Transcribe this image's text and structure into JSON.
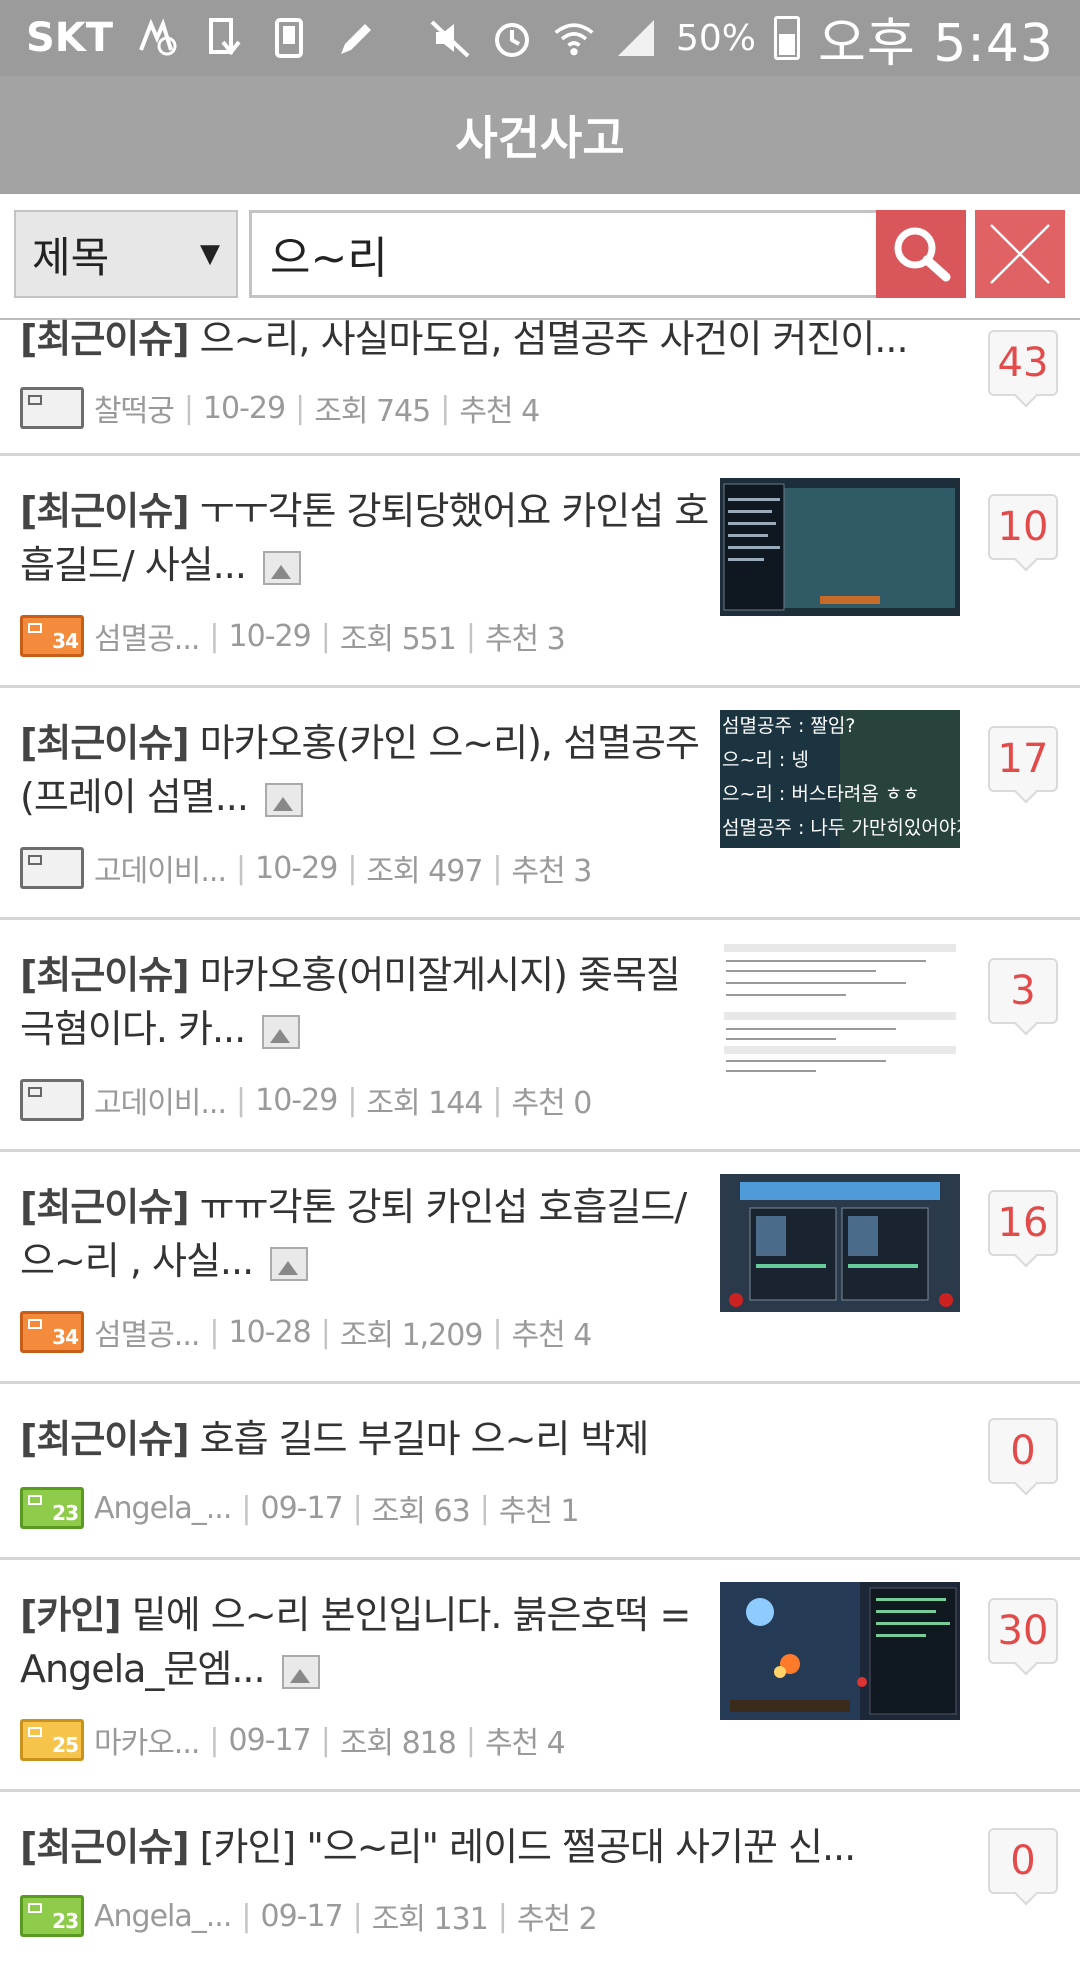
{
  "status_bar": {
    "carrier": "SKT",
    "battery": "50%",
    "time": "오후 5:43",
    "icons": [
      "notification-icon",
      "sd-card-icon",
      "sim-icon",
      "pen-icon",
      "mute-icon",
      "alarm-icon",
      "wifi-icon",
      "signal-icon",
      "battery-icon"
    ]
  },
  "header": {
    "title": "사건사고"
  },
  "search": {
    "field_option": "제목",
    "query": "으~리"
  },
  "posts": [
    {
      "tag": "[최근이슈]",
      "text": "으~리, 사실마도임, 섬멸공주 사건이 커진이...",
      "has_image": false,
      "level": "",
      "level_color": "gray",
      "author": "찰떡궁",
      "date": "10-29",
      "views": "조회 745",
      "recommend": "추천 4",
      "comments": "43"
    },
    {
      "tag": "[최근이슈]",
      "text": "ㅜㅜ각톤 강퇴당했어요 카인섭 호흡길드/ 사실...",
      "has_image": true,
      "level": "34",
      "level_color": "orange",
      "author": "섬멸공...",
      "date": "10-29",
      "views": "조회 551",
      "recommend": "추천 3",
      "comments": "10",
      "thumb": "game-chat-screenshot"
    },
    {
      "tag": "[최근이슈]",
      "text": "마카오홍(카인 으~리), 섬멸공주 (프레이 섬멸...",
      "has_image": true,
      "level": "",
      "level_color": "gray",
      "author": "고데이비...",
      "date": "10-29",
      "views": "조회 497",
      "recommend": "추천 3",
      "comments": "17",
      "thumb": "game-dialog-screenshot",
      "thumb_lines": [
        "섬멸공주 : 짤임?",
        "으~리 : 넹",
        "으~리 : 버스타려옴 ㅎㅎ",
        "섬멸공주 : 나두 가만히있어야지"
      ]
    },
    {
      "tag": "[최근이슈]",
      "text": "마카오홍(어미잘게시지) 좆목질 극혐이다. 카...",
      "has_image": true,
      "level": "",
      "level_color": "gray",
      "author": "고데이비...",
      "date": "10-29",
      "views": "조회 144",
      "recommend": "추천 0",
      "comments": "3",
      "thumb": "forum-text-screenshot"
    },
    {
      "tag": "[최근이슈]",
      "text": "ㅠㅠ각톤 강퇴 카인섭 호흡길드/으~리 , 사실...",
      "has_image": true,
      "level": "34",
      "level_color": "orange",
      "author": "섬멸공...",
      "date": "10-28",
      "views": "조회 1,209",
      "recommend": "추천 4",
      "comments": "16",
      "thumb": "game-inventory-screenshot"
    },
    {
      "tag": "[최근이슈]",
      "text": "호흡 길드 부길마 으~리 박제",
      "has_image": false,
      "level": "23",
      "level_color": "green",
      "author": "Angela_...",
      "date": "09-17",
      "views": "조회 63",
      "recommend": "추천 1",
      "comments": "0"
    },
    {
      "tag": "[카인]",
      "text": "밑에 으~리 본인입니다. 붉은호떡 = Angela_문엠...",
      "has_image": true,
      "level": "25",
      "level_color": "yellow",
      "author": "마카오...",
      "date": "09-17",
      "views": "조회 818",
      "recommend": "추천 4",
      "comments": "30",
      "thumb": "game-battle-screenshot"
    },
    {
      "tag": "[최근이슈]",
      "text": "[카인] \"으~리\" 레이드 쩔공대 사기꾼 신...",
      "has_image": false,
      "level": "23",
      "level_color": "green",
      "author": "Angela_...",
      "date": "09-17",
      "views": "조회 131",
      "recommend": "추천 2",
      "comments": "0"
    }
  ]
}
